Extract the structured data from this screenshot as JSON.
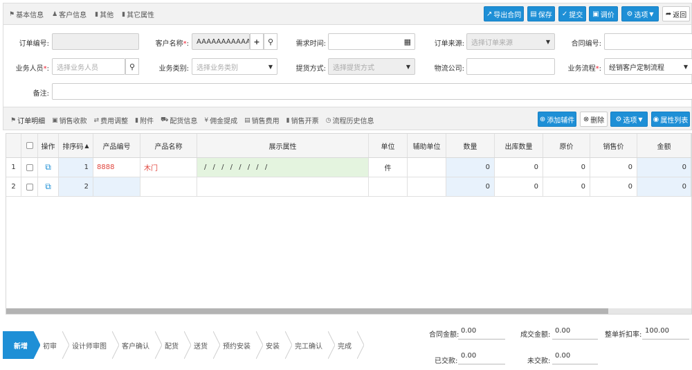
{
  "top_tabs": [
    {
      "icon": "tag-icon",
      "label": "基本信息"
    },
    {
      "icon": "user-icon",
      "label": "客户信息"
    },
    {
      "icon": "bookmark-icon",
      "label": "其他"
    },
    {
      "icon": "bookmark-icon",
      "label": "其它属性"
    }
  ],
  "toolbar": {
    "export_contract": "导出合同",
    "save": "保存",
    "submit": "提交",
    "adjust_price": "调价",
    "options": "选项",
    "back": "返回"
  },
  "form": {
    "order_no": {
      "label": "订单编号:",
      "value": ""
    },
    "customer_name": {
      "label": "客户名称",
      "required": "*",
      "colon": ":",
      "value": "AAAAAAAAAAAA"
    },
    "demand_time": {
      "label": "需求时间:",
      "value": ""
    },
    "order_source": {
      "label": "订单来源:",
      "placeholder": "选择订单来源"
    },
    "contract_no": {
      "label": "合同编号:",
      "value": ""
    },
    "salesperson": {
      "label": "业务人员",
      "required": "*",
      "colon": ":",
      "placeholder": "选择业务人员"
    },
    "business_type": {
      "label": "业务类别:",
      "placeholder": "选择业务类别"
    },
    "pickup_method": {
      "label": "提货方式:",
      "placeholder": "选择提货方式"
    },
    "logistics": {
      "label": "物流公司:",
      "value": ""
    },
    "workflow": {
      "label": "业务流程",
      "required": "*",
      "colon": ":",
      "value": "经销客户定制流程"
    },
    "remark": {
      "label": "备注:",
      "value": ""
    }
  },
  "sub_tabs": [
    {
      "icon": "tag-icon",
      "label": "订单明细"
    },
    {
      "icon": "money-icon",
      "label": "销售收款"
    },
    {
      "icon": "exchange-icon",
      "label": "费用调整"
    },
    {
      "icon": "file-icon",
      "label": "附件"
    },
    {
      "icon": "truck-icon",
      "label": "配货信息"
    },
    {
      "icon": "yen-icon",
      "label": "佣金提成"
    },
    {
      "icon": "card-icon",
      "label": "销售费用"
    },
    {
      "icon": "doc-icon",
      "label": "销售开票"
    },
    {
      "icon": "history-icon",
      "label": "流程历史信息"
    }
  ],
  "sub_toolbar": {
    "add_accessory": "添加辅件",
    "delete": "删除",
    "options": "选项",
    "attribute_list": "属性列表"
  },
  "table": {
    "headers": [
      "操作",
      "排序码",
      "产品编号",
      "产品名称",
      "展示属性",
      "单位",
      "辅助单位",
      "数量",
      "出库数量",
      "原价",
      "销售价",
      "金额"
    ],
    "rows": [
      {
        "idx": "1",
        "sort": "1",
        "product_no": "8888",
        "product_name": "木门",
        "attrs": "/ / / / / / / /",
        "unit": "件",
        "aux_unit": "",
        "qty": "0",
        "out_qty": "0",
        "orig_price": "0",
        "sale_price": "0",
        "amount": "0"
      },
      {
        "idx": "2",
        "sort": "2",
        "product_no": "",
        "product_name": "",
        "attrs": "",
        "unit": "",
        "aux_unit": "",
        "qty": "0",
        "out_qty": "0",
        "orig_price": "0",
        "sale_price": "0",
        "amount": "0"
      }
    ]
  },
  "steps": [
    "新增",
    "初审",
    "设计师审图",
    "客户确认",
    "配货",
    "送货",
    "预约安装",
    "安装",
    "完工确认",
    "完成"
  ],
  "active_step": 0,
  "summary": {
    "contract_amount": {
      "label": "合同金额:",
      "value": "0.00"
    },
    "deal_amount": {
      "label": "成交金额:",
      "value": "0.00"
    },
    "discount_rate": {
      "label": "整单折扣率:",
      "value": "100.00"
    },
    "paid": {
      "label": "已交款:",
      "value": "0.00"
    },
    "unpaid": {
      "label": "未交款:",
      "value": "0.00"
    }
  },
  "colors": {
    "accent": "#1e8fd6",
    "red_text": "#e0443c"
  }
}
